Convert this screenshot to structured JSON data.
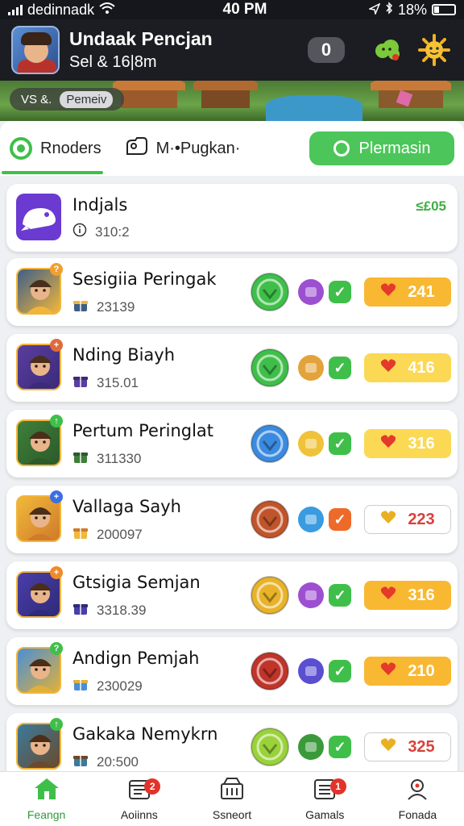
{
  "status_bar": {
    "carrier": "dedinnadk",
    "time": "40 PM",
    "battery": "18%"
  },
  "header": {
    "title": "Undaak Pencjan",
    "subtitle": "Sel & 16|8m",
    "badge_value": "0"
  },
  "banner": {
    "vs_label": "VS &.",
    "mode_label": "Pemeiv"
  },
  "tabs": {
    "tab1_label": "Rnoders",
    "tab2_label": "M·•Pugkan·",
    "cta_label": "Plermasin"
  },
  "first_card": {
    "name": "Indjals",
    "sub": "310:2",
    "score": "≤£05"
  },
  "rows": [
    {
      "name": "Sesigiia Peringak",
      "sub": "23139",
      "value": "241",
      "pill_style": "orange",
      "check_color": "#3fbf4a",
      "corner": "?",
      "corner_color": "#f0a030",
      "icon_colors": [
        "#3d5f88",
        "#f2b53a"
      ],
      "badge1_color": "#3fbf4a",
      "badge2_color": "#9d4fd1"
    },
    {
      "name": "Nding Biayh",
      "sub": "315.01",
      "value": "416",
      "pill_style": "yellow",
      "check_color": "#3fbf4a",
      "corner": "+",
      "corner_color": "#e06a3a",
      "icon_colors": [
        "#5a3e9e",
        "#3b2a7a"
      ],
      "badge1_color": "#3fbf4a",
      "badge2_color": "#e3a23a"
    },
    {
      "name": "Pertum Peringlat",
      "sub": "311330",
      "value": "316",
      "pill_style": "yellow",
      "check_color": "#3fbf4a",
      "corner": "↑",
      "corner_color": "#3fbf4a",
      "icon_colors": [
        "#3f7f3a",
        "#2c5a2a"
      ],
      "badge1_color": "#3a8be0",
      "badge2_color": "#f0c23a"
    },
    {
      "name": "Vallaga Sayh",
      "sub": "200097",
      "value": "223",
      "pill_style": "white",
      "check_color": "#ee6a2a",
      "corner": "+",
      "corner_color": "#3a6fe0",
      "icon_colors": [
        "#f0b93a",
        "#d07a2a"
      ],
      "badge1_color": "#c0542a",
      "badge2_color": "#3a9be0"
    },
    {
      "name": "Gtsigia Semjan",
      "sub": "3318.39",
      "value": "316",
      "pill_style": "orange",
      "check_color": "#3fbf4a",
      "corner": "+",
      "corner_color": "#f08a2a",
      "icon_colors": [
        "#4a3ea8",
        "#2f2a7a"
      ],
      "badge1_color": "#e8b32a",
      "badge2_color": "#9d4fd1"
    },
    {
      "name": "Andign Pemjah",
      "sub": "230029",
      "value": "210",
      "pill_style": "orange",
      "check_color": "#3fbf4a",
      "corner": "?",
      "corner_color": "#3fbf4a",
      "icon_colors": [
        "#4a8fd6",
        "#e0b03a"
      ],
      "badge1_color": "#c0342a",
      "badge2_color": "#5a4fd1"
    },
    {
      "name": "Gakaka Nemykrn",
      "sub": "20:500",
      "value": "325",
      "pill_style": "white",
      "check_color": "#3fbf4a",
      "corner": "↑",
      "corner_color": "#3fbf4a",
      "icon_colors": [
        "#3a7a9e",
        "#6a4a2a"
      ],
      "badge1_color": "#9ad23a",
      "badge2_color": "#3a9a3a"
    }
  ],
  "bottom_nav": [
    {
      "label": "Feangn",
      "icon": "home-icon",
      "badge": ""
    },
    {
      "label": "Aoiinns",
      "icon": "calendar-icon",
      "badge": "2"
    },
    {
      "label": "Ssneort",
      "icon": "store-icon",
      "badge": ""
    },
    {
      "label": "Gamals",
      "icon": "list-icon",
      "badge": "1"
    },
    {
      "label": "Fonada",
      "icon": "profile-icon",
      "badge": ""
    }
  ]
}
